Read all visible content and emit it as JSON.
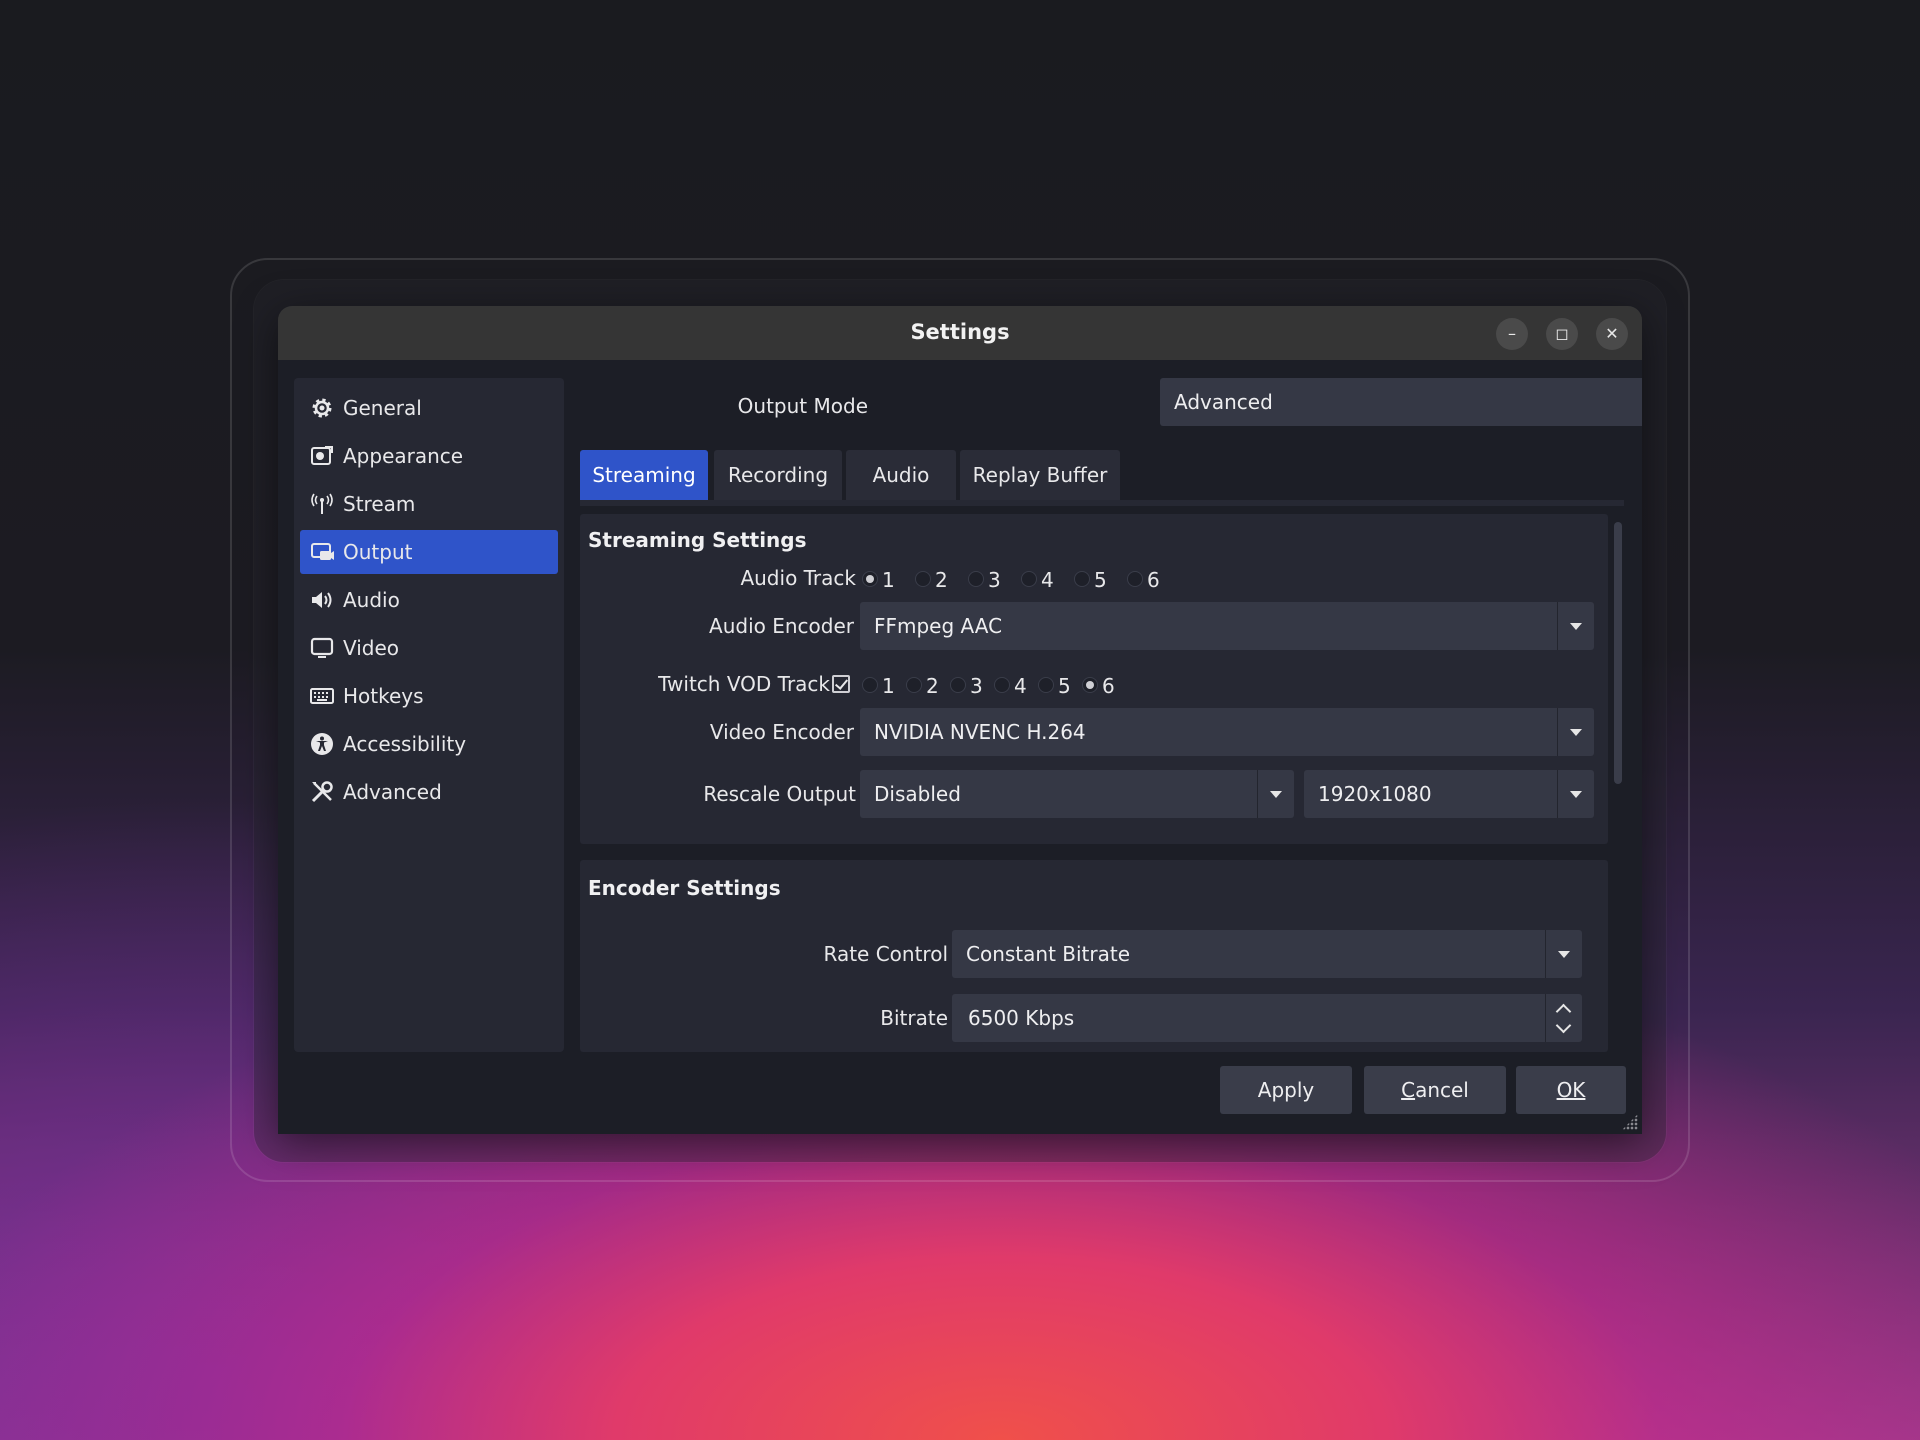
{
  "window": {
    "title": "Settings"
  },
  "sidebar": {
    "items": [
      {
        "label": "General",
        "icon": "gear-icon"
      },
      {
        "label": "Appearance",
        "icon": "appearance-icon"
      },
      {
        "label": "Stream",
        "icon": "antenna-icon"
      },
      {
        "label": "Output",
        "icon": "output-icon",
        "active": true
      },
      {
        "label": "Audio",
        "icon": "speaker-icon"
      },
      {
        "label": "Video",
        "icon": "monitor-icon"
      },
      {
        "label": "Hotkeys",
        "icon": "keyboard-icon"
      },
      {
        "label": "Accessibility",
        "icon": "accessibility-icon"
      },
      {
        "label": "Advanced",
        "icon": "tools-icon"
      }
    ]
  },
  "output_mode": {
    "label": "Output Mode",
    "value": "Advanced"
  },
  "tabs": [
    {
      "label": "Streaming",
      "active": true
    },
    {
      "label": "Recording"
    },
    {
      "label": "Audio"
    },
    {
      "label": "Replay Buffer"
    }
  ],
  "streaming": {
    "title": "Streaming Settings",
    "audio_track": {
      "label": "Audio Track",
      "options": [
        "1",
        "2",
        "3",
        "4",
        "5",
        "6"
      ],
      "selected": "1"
    },
    "audio_encoder": {
      "label": "Audio Encoder",
      "value": "FFmpeg AAC"
    },
    "twitch_vod": {
      "label": "Twitch VOD Track",
      "checked": true,
      "options": [
        "1",
        "2",
        "3",
        "4",
        "5",
        "6"
      ],
      "selected": "6"
    },
    "video_encoder": {
      "label": "Video Encoder",
      "value": "NVIDIA NVENC H.264"
    },
    "rescale": {
      "label": "Rescale Output",
      "value": "Disabled",
      "resolution": "1920x1080"
    }
  },
  "encoder": {
    "title": "Encoder Settings",
    "rate_control": {
      "label": "Rate Control",
      "value": "Constant Bitrate"
    },
    "bitrate": {
      "label": "Bitrate",
      "value": "6500 Kbps"
    }
  },
  "buttons": {
    "apply": "Apply",
    "cancel_rest": "ancel",
    "cancel_mnemonic": "C",
    "ok": "OK"
  },
  "colors": {
    "accent": "#2f54c9",
    "panel": "#262833",
    "window_bg": "#1c1e26"
  }
}
